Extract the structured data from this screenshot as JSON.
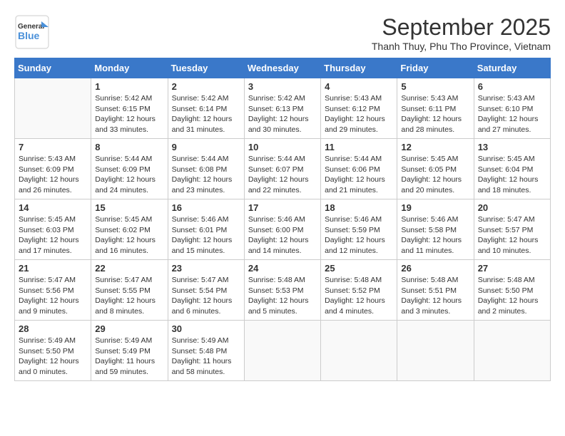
{
  "logo": {
    "general": "General",
    "blue": "Blue"
  },
  "header": {
    "month_title": "September 2025",
    "location": "Thanh Thuy, Phu Tho Province, Vietnam"
  },
  "weekdays": [
    "Sunday",
    "Monday",
    "Tuesday",
    "Wednesday",
    "Thursday",
    "Friday",
    "Saturday"
  ],
  "weeks": [
    [
      {
        "day": "",
        "info": ""
      },
      {
        "day": "1",
        "info": "Sunrise: 5:42 AM\nSunset: 6:15 PM\nDaylight: 12 hours\nand 33 minutes."
      },
      {
        "day": "2",
        "info": "Sunrise: 5:42 AM\nSunset: 6:14 PM\nDaylight: 12 hours\nand 31 minutes."
      },
      {
        "day": "3",
        "info": "Sunrise: 5:42 AM\nSunset: 6:13 PM\nDaylight: 12 hours\nand 30 minutes."
      },
      {
        "day": "4",
        "info": "Sunrise: 5:43 AM\nSunset: 6:12 PM\nDaylight: 12 hours\nand 29 minutes."
      },
      {
        "day": "5",
        "info": "Sunrise: 5:43 AM\nSunset: 6:11 PM\nDaylight: 12 hours\nand 28 minutes."
      },
      {
        "day": "6",
        "info": "Sunrise: 5:43 AM\nSunset: 6:10 PM\nDaylight: 12 hours\nand 27 minutes."
      }
    ],
    [
      {
        "day": "7",
        "info": "Sunrise: 5:43 AM\nSunset: 6:09 PM\nDaylight: 12 hours\nand 26 minutes."
      },
      {
        "day": "8",
        "info": "Sunrise: 5:44 AM\nSunset: 6:09 PM\nDaylight: 12 hours\nand 24 minutes."
      },
      {
        "day": "9",
        "info": "Sunrise: 5:44 AM\nSunset: 6:08 PM\nDaylight: 12 hours\nand 23 minutes."
      },
      {
        "day": "10",
        "info": "Sunrise: 5:44 AM\nSunset: 6:07 PM\nDaylight: 12 hours\nand 22 minutes."
      },
      {
        "day": "11",
        "info": "Sunrise: 5:44 AM\nSunset: 6:06 PM\nDaylight: 12 hours\nand 21 minutes."
      },
      {
        "day": "12",
        "info": "Sunrise: 5:45 AM\nSunset: 6:05 PM\nDaylight: 12 hours\nand 20 minutes."
      },
      {
        "day": "13",
        "info": "Sunrise: 5:45 AM\nSunset: 6:04 PM\nDaylight: 12 hours\nand 18 minutes."
      }
    ],
    [
      {
        "day": "14",
        "info": "Sunrise: 5:45 AM\nSunset: 6:03 PM\nDaylight: 12 hours\nand 17 minutes."
      },
      {
        "day": "15",
        "info": "Sunrise: 5:45 AM\nSunset: 6:02 PM\nDaylight: 12 hours\nand 16 minutes."
      },
      {
        "day": "16",
        "info": "Sunrise: 5:46 AM\nSunset: 6:01 PM\nDaylight: 12 hours\nand 15 minutes."
      },
      {
        "day": "17",
        "info": "Sunrise: 5:46 AM\nSunset: 6:00 PM\nDaylight: 12 hours\nand 14 minutes."
      },
      {
        "day": "18",
        "info": "Sunrise: 5:46 AM\nSunset: 5:59 PM\nDaylight: 12 hours\nand 12 minutes."
      },
      {
        "day": "19",
        "info": "Sunrise: 5:46 AM\nSunset: 5:58 PM\nDaylight: 12 hours\nand 11 minutes."
      },
      {
        "day": "20",
        "info": "Sunrise: 5:47 AM\nSunset: 5:57 PM\nDaylight: 12 hours\nand 10 minutes."
      }
    ],
    [
      {
        "day": "21",
        "info": "Sunrise: 5:47 AM\nSunset: 5:56 PM\nDaylight: 12 hours\nand 9 minutes."
      },
      {
        "day": "22",
        "info": "Sunrise: 5:47 AM\nSunset: 5:55 PM\nDaylight: 12 hours\nand 8 minutes."
      },
      {
        "day": "23",
        "info": "Sunrise: 5:47 AM\nSunset: 5:54 PM\nDaylight: 12 hours\nand 6 minutes."
      },
      {
        "day": "24",
        "info": "Sunrise: 5:48 AM\nSunset: 5:53 PM\nDaylight: 12 hours\nand 5 minutes."
      },
      {
        "day": "25",
        "info": "Sunrise: 5:48 AM\nSunset: 5:52 PM\nDaylight: 12 hours\nand 4 minutes."
      },
      {
        "day": "26",
        "info": "Sunrise: 5:48 AM\nSunset: 5:51 PM\nDaylight: 12 hours\nand 3 minutes."
      },
      {
        "day": "27",
        "info": "Sunrise: 5:48 AM\nSunset: 5:50 PM\nDaylight: 12 hours\nand 2 minutes."
      }
    ],
    [
      {
        "day": "28",
        "info": "Sunrise: 5:49 AM\nSunset: 5:50 PM\nDaylight: 12 hours\nand 0 minutes."
      },
      {
        "day": "29",
        "info": "Sunrise: 5:49 AM\nSunset: 5:49 PM\nDaylight: 11 hours\nand 59 minutes."
      },
      {
        "day": "30",
        "info": "Sunrise: 5:49 AM\nSunset: 5:48 PM\nDaylight: 11 hours\nand 58 minutes."
      },
      {
        "day": "",
        "info": ""
      },
      {
        "day": "",
        "info": ""
      },
      {
        "day": "",
        "info": ""
      },
      {
        "day": "",
        "info": ""
      }
    ]
  ]
}
